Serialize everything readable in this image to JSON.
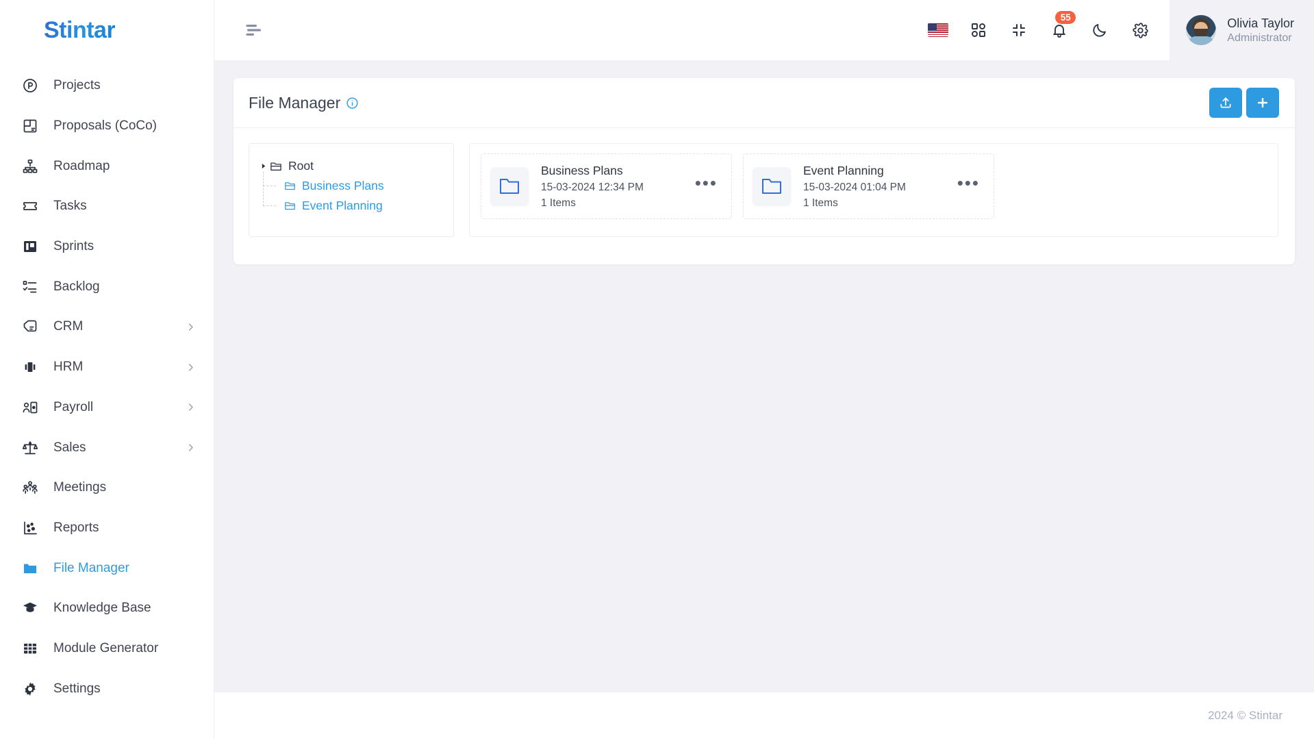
{
  "brand": {
    "name": "Stintar"
  },
  "sidebar": {
    "items": [
      {
        "label": "Projects",
        "icon": "projects-circle-p-icon",
        "has_chevron": false,
        "active": false
      },
      {
        "label": "Proposals (CoCo)",
        "icon": "proposals-layout-icon",
        "has_chevron": false,
        "active": false
      },
      {
        "label": "Roadmap",
        "icon": "roadmap-hierarchy-icon",
        "has_chevron": false,
        "active": false
      },
      {
        "label": "Tasks",
        "icon": "tasks-ticket-icon",
        "has_chevron": false,
        "active": false
      },
      {
        "label": "Sprints",
        "icon": "sprints-board-icon",
        "has_chevron": false,
        "active": false
      },
      {
        "label": "Backlog",
        "icon": "backlog-checklist-icon",
        "has_chevron": false,
        "active": false
      },
      {
        "label": "CRM",
        "icon": "crm-handshake-icon",
        "has_chevron": true,
        "active": false
      },
      {
        "label": "HRM",
        "icon": "hrm-id-card-icon",
        "has_chevron": true,
        "active": false
      },
      {
        "label": "Payroll",
        "icon": "payroll-person-card-icon",
        "has_chevron": true,
        "active": false
      },
      {
        "label": "Sales",
        "icon": "sales-scale-icon",
        "has_chevron": true,
        "active": false
      },
      {
        "label": "Meetings",
        "icon": "meetings-people-icon",
        "has_chevron": false,
        "active": false
      },
      {
        "label": "Reports",
        "icon": "reports-scatter-icon",
        "has_chevron": false,
        "active": false
      },
      {
        "label": "File Manager",
        "icon": "folder-icon",
        "has_chevron": false,
        "active": true
      },
      {
        "label": "Knowledge Base",
        "icon": "graduation-cap-icon",
        "has_chevron": false,
        "active": false
      },
      {
        "label": "Module Generator",
        "icon": "grid-table-icon",
        "has_chevron": false,
        "active": false
      },
      {
        "label": "Settings",
        "icon": "gear-icon",
        "has_chevron": false,
        "active": false
      }
    ]
  },
  "topbar": {
    "menu_toggle_icon": "hamburger-icon",
    "icons": [
      {
        "name": "language-flag-us-icon"
      },
      {
        "name": "apps-grid-icon"
      },
      {
        "name": "fullscreen-compress-icon"
      },
      {
        "name": "notifications-bell-icon"
      },
      {
        "name": "dark-mode-moon-icon"
      },
      {
        "name": "settings-gear-icon"
      }
    ],
    "notification_count": "55",
    "user": {
      "name": "Olivia Taylor",
      "role": "Administrator"
    }
  },
  "page": {
    "title": "File Manager",
    "info_icon": "info-circle-icon",
    "upload_button_icon": "upload-icon",
    "add_button_icon": "plus-icon"
  },
  "tree": {
    "root": {
      "label": "Root",
      "icon": "folder-open-icon",
      "caret": "caret-right-icon"
    },
    "children": [
      {
        "label": "Business Plans",
        "icon": "folder-open-icon"
      },
      {
        "label": "Event Planning",
        "icon": "folder-open-icon"
      }
    ]
  },
  "folders": [
    {
      "name": "Business Plans",
      "date": "15-03-2024 12:34 PM",
      "items": "1 Items",
      "icon": "folder-icon",
      "menu_icon": "ellipsis-icon"
    },
    {
      "name": "Event Planning",
      "date": "15-03-2024 01:04 PM",
      "items": "1 Items",
      "icon": "folder-icon",
      "menu_icon": "ellipsis-icon"
    }
  ],
  "footer": {
    "copyright": "2024 © Stintar"
  },
  "colors": {
    "accent": "#2E9BE0",
    "badge": "#F4613E",
    "page_bg": "#F1F1F6",
    "text": "#2b3445",
    "muted": "#8b93a5"
  }
}
